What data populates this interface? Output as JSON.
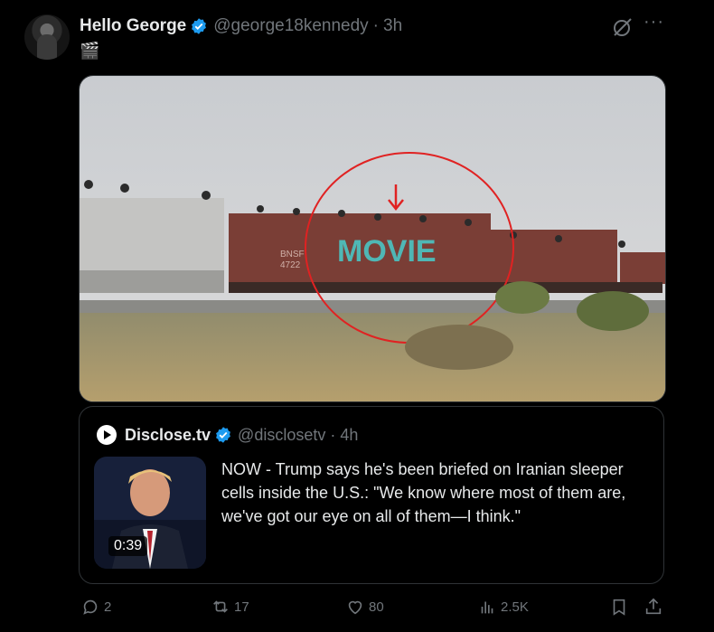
{
  "post": {
    "author_name": "Hello George",
    "handle": "@george18kennedy",
    "separator": "·",
    "time": "3h",
    "body_emoji": "🎬",
    "more_label": "···",
    "image": {
      "graffiti_text": "MOVIE",
      "car_text_1": "BNSF",
      "car_text_2": "4722"
    }
  },
  "quote": {
    "author_name": "Disclose.tv",
    "handle": "@disclosetv",
    "separator": "·",
    "time": "4h",
    "text": "NOW - Trump says he's been briefed on Iranian sleeper cells inside the U.S.: \"We know where most of them are, we've got our eye on all of them—I think.\"",
    "video_duration": "0:39"
  },
  "actions": {
    "replies": "2",
    "reposts": "17",
    "likes": "80",
    "views": "2.5K"
  },
  "colors": {
    "background": "#000000",
    "text": "#e7e9ea",
    "muted": "#71767b",
    "verified": "#1d9bf0",
    "border": "#2f3336"
  }
}
